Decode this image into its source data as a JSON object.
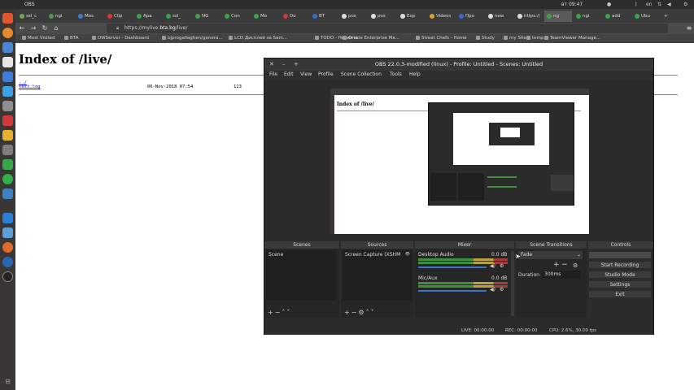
{
  "system": {
    "app_name": "OBS",
    "clock": "вт 09:47",
    "language": "en"
  },
  "browser": {
    "tabs": [
      "ssl_c",
      "ngi",
      "Mos",
      "Clip",
      "Apa",
      "ssl_",
      "NG",
      "Con",
      "Mo",
      "Do",
      "BT",
      "pos",
      "pos",
      "Exp",
      "Videos",
      "Про",
      "new",
      "https://",
      "ng",
      "ngi",
      "add",
      "Ubu"
    ],
    "active_tab_index": 18,
    "url": "https://mylive.bta.bg/live/",
    "url_display_prefix": "https://mylive.",
    "url_display_domain": "bta.bg",
    "url_display_suffix": "/live/",
    "bookmarks": [
      "Most Visited",
      "BTA",
      "DWServer - Dashboard",
      "bjprogallaghen/genera...",
      "LCD Дисплей за Sam...",
      "TODO - Ничията",
      "Oracle Enterprise Ma...",
      "Street Chefs - Home",
      "Study",
      "my Sites",
      "temp",
      "TeamViewer Manage..."
    ]
  },
  "page": {
    "title": "Index of /live/",
    "parent_link": "../",
    "file_name": "test.log",
    "file_date": "06-Nov-2018 07:54",
    "file_size": "113"
  },
  "obs": {
    "title": "OBS 22.0.3-modified (linux) - Profile: Untitled - Scenes: Untitled",
    "menu": [
      "File",
      "Edit",
      "View",
      "Profile",
      "Scene Collection",
      "Tools",
      "Help"
    ],
    "docks": {
      "scenes": {
        "title": "Scenes",
        "items": [
          "Scene"
        ]
      },
      "sources": {
        "title": "Sources",
        "items": [
          "Screen Capture (XSHM"
        ]
      },
      "mixer": {
        "title": "Mixer",
        "channels": [
          {
            "name": "Desktop Audio",
            "db": "0.0 dB"
          },
          {
            "name": "Mic/Aux",
            "db": "0.0 dB"
          }
        ]
      },
      "transitions": {
        "title": "Scene Transitions",
        "selected": "Fade",
        "duration_label": "Duration",
        "duration_value": "300ms"
      },
      "controls": {
        "title": "Controls",
        "buttons": [
          "Start Recording",
          "Studio Mode",
          "Settings",
          "Exit"
        ]
      }
    },
    "status": {
      "live": "LIVE: 00:00:00",
      "rec": "REC: 00:00:00",
      "cpu": "CPU: 2.6%, 30.00 fps"
    }
  },
  "colors": {
    "accent_meter_green": "#3f8f3f",
    "meter_yellow": "#b9a43a",
    "meter_red": "#a53c3c",
    "slider_blue": "#3f72c8",
    "link_blue": "#0000ee"
  }
}
